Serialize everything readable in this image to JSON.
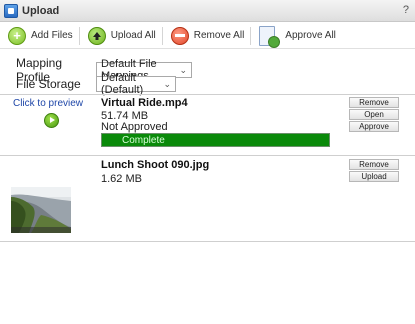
{
  "window": {
    "title": "Upload",
    "help": "?"
  },
  "toolbar": {
    "add_files": "Add Files",
    "upload_all": "Upload All",
    "remove_all": "Remove All",
    "approve_all": "Approve All"
  },
  "form": {
    "mapping_profile_label": "Mapping Profile",
    "mapping_profile_value": "Default File Mappings",
    "file_storage_label": "File Storage",
    "file_storage_value": "Default (Default)"
  },
  "files": [
    {
      "preview_link": "Click to preview",
      "name": "Virtual Ride.mp4",
      "size": "51.74 MB",
      "status": "Not Approved",
      "progress_label": "Complete",
      "progress": 1.0,
      "actions": [
        "Remove",
        "Open",
        "Approve"
      ]
    },
    {
      "name": "Lunch Shoot 090.jpg",
      "size": "1.62 MB",
      "actions": [
        "Remove",
        "Upload"
      ]
    }
  ],
  "icons": {
    "add": "plus-circle-icon",
    "upload": "up-arrow-circle-icon",
    "remove": "minus-circle-icon",
    "approve": "document-check-icon",
    "play": "play-icon"
  }
}
